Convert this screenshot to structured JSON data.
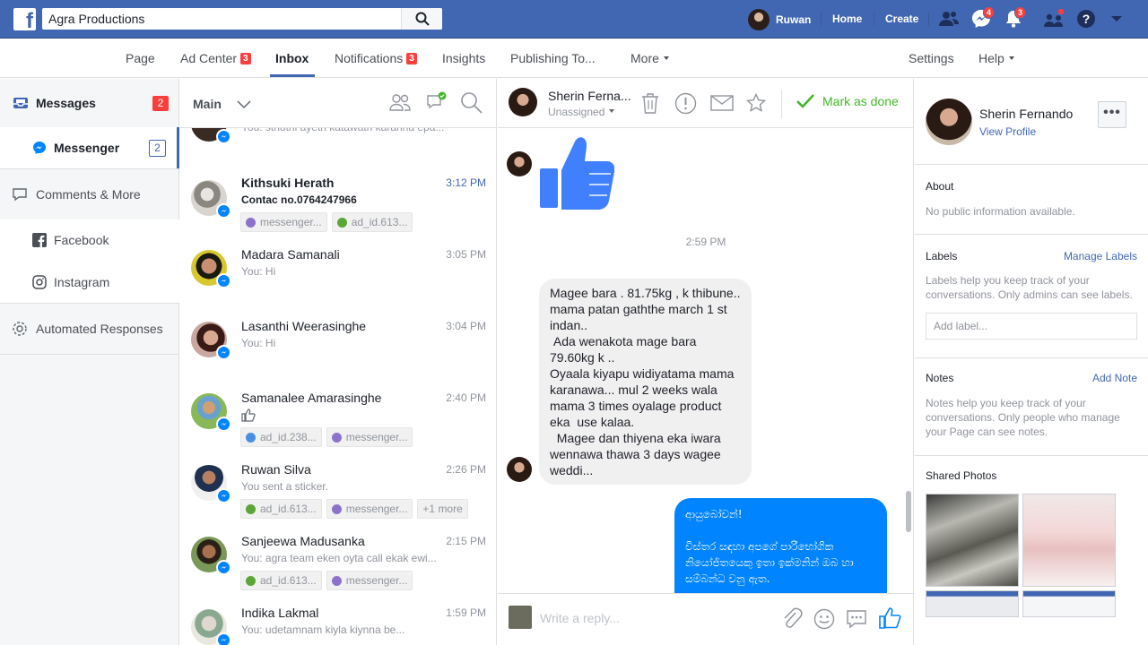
{
  "topbar": {
    "logo_letter": "f",
    "search_value": "Agra Productions",
    "user_name": "Ruwan",
    "home": "Home",
    "create": "Create",
    "messages_badge": "4",
    "notifications_badge": "3"
  },
  "pagenav": {
    "items": [
      "Page",
      "Ad Center",
      "Inbox",
      "Notifications",
      "Insights",
      "Publishing To...",
      "More"
    ],
    "ad_center_badge": "3",
    "notifications_badge": "3",
    "settings": "Settings",
    "help": "Help"
  },
  "sidebar": {
    "messages": "Messages",
    "messages_badge": "2",
    "messenger": "Messenger",
    "messenger_badge": "2",
    "comments": "Comments & More",
    "facebook": "Facebook",
    "instagram": "Instagram",
    "automated": "Automated Responses"
  },
  "convlist": {
    "title": "Main",
    "top_snippet": "You: sthuthi ayeth katawath karanna epa...",
    "items": [
      {
        "name": "Kithsuki Herath",
        "time": "3:12 PM",
        "snippet": "Contac no.0764247966",
        "tags": [
          "messenger...",
          "ad_id.613..."
        ]
      },
      {
        "name": "Madara Samanali",
        "time": "3:05 PM",
        "snippet": "You: Hi"
      },
      {
        "name": "Lasanthi Weerasinghe",
        "time": "3:04 PM",
        "snippet": "You: Hi"
      },
      {
        "name": "Samanalee Amarasinghe",
        "time": "2:40 PM",
        "snippet": "",
        "tags": [
          "ad_id.238...",
          "messenger..."
        ]
      },
      {
        "name": "Ruwan Silva",
        "time": "2:26 PM",
        "snippet": "You sent a sticker.",
        "tags": [
          "ad_id.613...",
          "messenger...",
          "+1 more"
        ]
      },
      {
        "name": "Sanjeewa Madusanka",
        "time": "2:15 PM",
        "snippet": "You: agra team eken oyta call ekak ewi...",
        "tags": [
          "ad_id.613...",
          "messenger..."
        ]
      },
      {
        "name": "Indika Lakmal",
        "time": "1:59 PM",
        "snippet": "You: udetamnam kiyla kiynna be..."
      }
    ]
  },
  "chat": {
    "name": "Sherin Ferna...",
    "assign": "Unassigned",
    "mark_done": "Mark as done",
    "timestamp": "2:59 PM",
    "incoming": "Magee bara . 81.75kg , k thibune..\nmama patan gaththe march 1 st\nindan..\n Ada wenakota mage bara\n79.60kg k ..\nOyaala kiyapu widiyatama mama\nkaranawa... mul 2 weeks wala\nmama 3 times oyalage product\neka  use kalaa.\n  Magee dan thiyena eka iwara\nwennawa thawa 3 days wagee\nweddi...",
    "outgoing": "ආයුබෝවන්!\n\nවිස්තර සඳහා අපගේ පාරිභෝගික\nනියෝජිතයෙකු ඉතා ඉක්මනින් ඔබ හා\nසම්බන්ධ වනු ඇත.",
    "reply_placeholder": "Write a reply..."
  },
  "info": {
    "name": "Sherin Fernando",
    "view_profile": "View Profile",
    "more": "•••",
    "about_title": "About",
    "about_text": "No public information available.",
    "labels_title": "Labels",
    "manage_labels": "Manage Labels",
    "labels_text": "Labels help you keep track of your conversations. Only admins can see labels.",
    "add_label_placeholder": "Add label...",
    "notes_title": "Notes",
    "add_note": "Add Note",
    "notes_text": "Notes help you keep track of your conversations. Only people who manage your Page can see notes.",
    "photos_title": "Shared Photos"
  },
  "colors": {
    "brand_blue": "#4267b2",
    "messenger_blue": "#0084ff",
    "done_green": "#42b72a",
    "badge_red": "#fa3e3e"
  }
}
